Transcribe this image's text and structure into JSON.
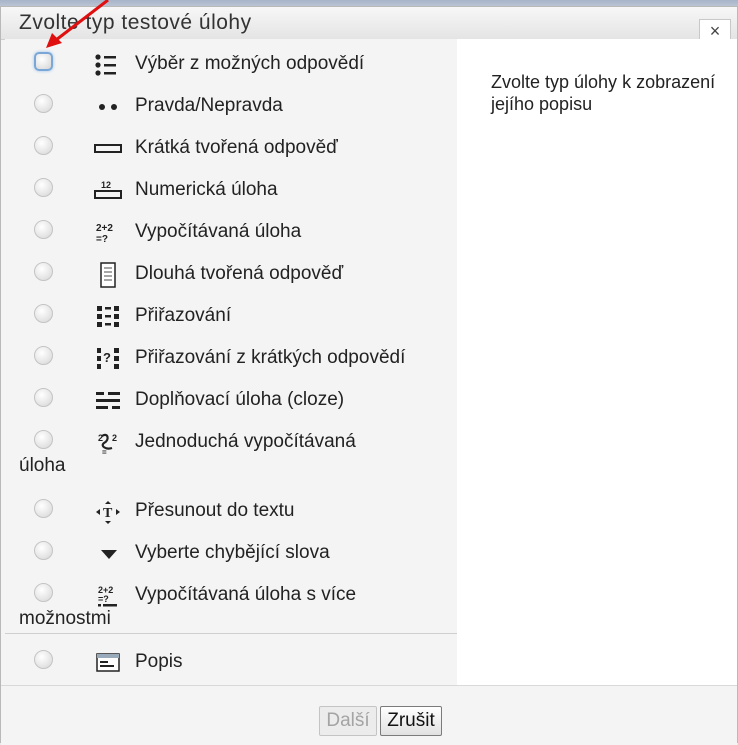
{
  "dialog": {
    "title": "Zvolte typ testové úlohy",
    "close_label": "×",
    "description": "Zvolte typ úlohy k zobrazení jejího popisu"
  },
  "options": [
    {
      "label": "Výběr z možných odpovědí",
      "icon": "multichoice-icon"
    },
    {
      "label": "Pravda/Nepravda",
      "icon": "truefalse-icon"
    },
    {
      "label": "Krátká tvořená odpověď",
      "icon": "shortanswer-icon"
    },
    {
      "label": "Numerická úloha",
      "icon": "numerical-icon"
    },
    {
      "label": "Vypočítávaná úloha",
      "icon": "calculated-icon"
    },
    {
      "label": "Dlouhá tvořená odpověď",
      "icon": "essay-icon"
    },
    {
      "label": "Přiřazování",
      "icon": "matching-icon"
    },
    {
      "label": "Přiřazování z krátkých odpovědí",
      "icon": "randomsamatch-icon"
    },
    {
      "label": "Doplňovací úloha (cloze)",
      "icon": "cloze-icon"
    },
    {
      "label": "Jednoduchá vypočítávaná",
      "label_cont": "úloha",
      "icon": "calculatedsimple-icon"
    },
    {
      "label": "Přesunout do textu",
      "icon": "ddwtos-icon"
    },
    {
      "label": "Vyberte chybějící slova",
      "icon": "gapselect-icon"
    },
    {
      "label": "Vypočítávaná úloha s více",
      "label_cont": "možnostmi",
      "icon": "calculatedmulti-icon"
    },
    {
      "label": "Popis",
      "icon": "description-icon"
    }
  ],
  "footer": {
    "next_label": "Další",
    "cancel_label": "Zrušit"
  },
  "colors": {
    "focus_ring": "#7aa7d8",
    "annotation_arrow": "#e01010"
  }
}
